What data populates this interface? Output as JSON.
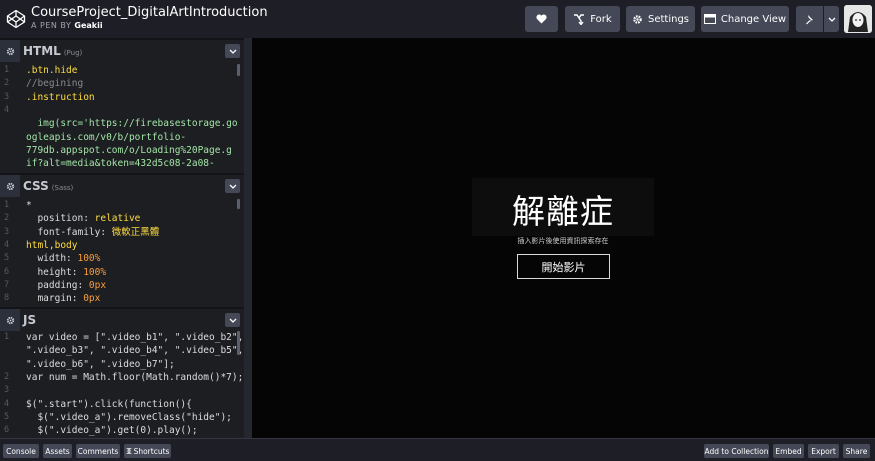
{
  "header": {
    "title": "CourseProject_DigitalArtIntroduction",
    "byline_prefix": "A PEN BY",
    "author": "Geakii",
    "fork_label": "Fork",
    "settings_label": "Settings",
    "change_view_label": "Change View"
  },
  "html_pane": {
    "title": "HTML",
    "sub": "(Pug)",
    "lines": [
      {
        "n": "1",
        "t": ".btn.hide"
      },
      {
        "n": "2",
        "t": "//begining"
      },
      {
        "n": "3",
        "t": ".instruction"
      },
      {
        "n": "4",
        "t": ""
      },
      {
        "n": "",
        "t": "  img(src='https://firebasestorage.go"
      },
      {
        "n": "",
        "t": "ogleapis.com/v0/b/portfolio-"
      },
      {
        "n": "",
        "t": "779db.appspot.com/o/Loading%20Page.g"
      },
      {
        "n": "",
        "t": "if?alt=media&token=432d5c08-2a08-"
      }
    ]
  },
  "css_pane": {
    "title": "CSS",
    "sub": "(Sass)",
    "lines": [
      {
        "n": "1",
        "sel": "*",
        "prop": "",
        "val": ""
      },
      {
        "n": "2",
        "sel": "",
        "prop": "  position: ",
        "val": "relative"
      },
      {
        "n": "3",
        "sel": "",
        "prop": "  font-family: ",
        "val": "微軟正黑體"
      },
      {
        "n": "4",
        "sel": "html,body",
        "prop": "",
        "val": ""
      },
      {
        "n": "5",
        "sel": "",
        "prop": "  width: ",
        "val": "100%"
      },
      {
        "n": "6",
        "sel": "",
        "prop": "  height: ",
        "val": "100%"
      },
      {
        "n": "7",
        "sel": "",
        "prop": "  padding: ",
        "val": "0px"
      },
      {
        "n": "8",
        "sel": "",
        "prop": "  margin: ",
        "val": "0px"
      }
    ]
  },
  "js_pane": {
    "title": "JS",
    "lines": [
      {
        "n": "1",
        "t": "var video = [\".video_b1\", \".video_b2\","
      },
      {
        "n": "",
        "t": "\".video_b3\", \".video_b4\", \".video_b5\","
      },
      {
        "n": "",
        "t": "\".video_b6\", \".video_b7\"];"
      },
      {
        "n": "2",
        "t": "var num = Math.floor(Math.random()*7);"
      },
      {
        "n": "3",
        "t": ""
      },
      {
        "n": "4",
        "t": "$(\".start\").click(function(){"
      },
      {
        "n": "5",
        "t": "  $(\".video_a\").removeClass(\"hide\");"
      },
      {
        "n": "6",
        "t": "  $(\".video_a\").get(0).play();"
      }
    ]
  },
  "preview": {
    "heading": "解離症",
    "instruction": "插入影片後使用資訊探索存在",
    "start_label": "開始影片"
  },
  "footer": {
    "console": "Console",
    "assets": "Assets",
    "comments": "Comments",
    "shortcuts": "Shortcuts",
    "add_to_collection": "Add to Collection",
    "embed": "Embed",
    "export": "Export",
    "share": "Share"
  },
  "colors": {
    "header_bg": "#1e1f26",
    "button_bg": "#444857",
    "pane_bg": "#1d1e22",
    "preview_bg": "#050505"
  }
}
